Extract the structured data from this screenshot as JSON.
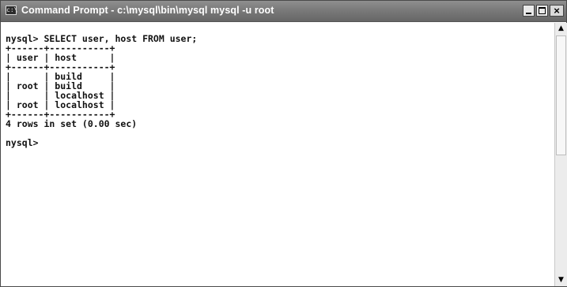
{
  "window": {
    "title": "Command Prompt - c:\\mysql\\bin\\mysql mysql -u root",
    "icon": "cmd-icon",
    "controls": {
      "minimize": "minimize-icon",
      "maximize": "maximize-icon",
      "close": "close-icon",
      "close_glyph": "×"
    }
  },
  "console": {
    "prompt_line": "nysql> SELECT user, host FROM user;",
    "table_border": "+------+-----------+",
    "header_row": "| user | host      |",
    "rows": [
      "|      | build     |",
      "| root | build     |",
      "|      | localhost |",
      "| root | localhost |"
    ],
    "summary": "4 rows in set (0.00 sec)",
    "final_prompt": "nysql>"
  },
  "scrollbar": {
    "up_glyph": "▲",
    "down_glyph": "▼"
  }
}
